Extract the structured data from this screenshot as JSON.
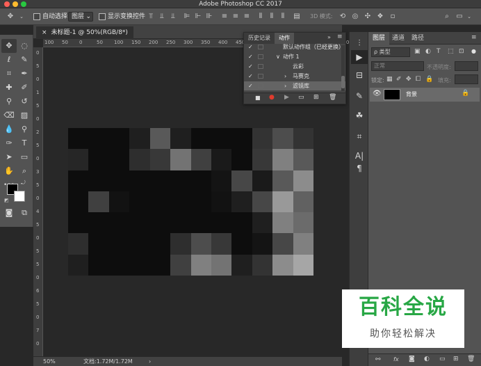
{
  "window": {
    "title": "Adobe Photoshop CC 2017"
  },
  "options_bar": {
    "auto_select_label": "自动选择:",
    "auto_select_value": "图层",
    "show_transform_label": "显示变换控件",
    "mode_3d_label": "3D 模式:"
  },
  "document": {
    "tab_title": "未标题-1 @ 50%(RGB/8*)",
    "close_label": "×",
    "ruler_top": [
      "100",
      "50",
      "0",
      "50",
      "100",
      "150",
      "200",
      "250",
      "300",
      "350",
      "400",
      "450",
      "500",
      "550",
      "600",
      "650",
      "700",
      "750",
      "800"
    ],
    "ruler_left": [
      "0",
      "5",
      "0",
      "1",
      "5",
      "0",
      "2",
      "5",
      "0",
      "3",
      "5",
      "0",
      "4",
      "5",
      "0",
      "5",
      "5",
      "0",
      "6",
      "5",
      "0",
      "7",
      "0"
    ]
  },
  "status": {
    "zoom": "50%",
    "doc_size": "文档:1.72M/1.72M",
    "arrow": "›"
  },
  "history_panel": {
    "tabs": [
      "历史记录",
      "动作"
    ],
    "active_tab": 1,
    "rows": [
      {
        "label": "默认动作组（已经更换）",
        "indent": 1,
        "expand": "",
        "check": "✓",
        "highlight": false
      },
      {
        "label": "动作 1",
        "indent": 1,
        "expand": "∨",
        "check": "✓",
        "highlight": false
      },
      {
        "label": "云彩",
        "indent": 2,
        "expand": "",
        "check": "✓",
        "highlight": false
      },
      {
        "label": "马赛克",
        "indent": 2,
        "expand": "›",
        "check": "✓",
        "highlight": false
      },
      {
        "label": "滤镜库",
        "indent": 2,
        "expand": "›",
        "check": "✓",
        "highlight": true
      }
    ]
  },
  "layers_panel": {
    "tabs": [
      "图层",
      "通道",
      "路径"
    ],
    "active_tab": 0,
    "filter_label": "ρ 类型",
    "blend_mode": "正常",
    "opacity_label": "不透明度:",
    "lock_label": "锁定:",
    "fill_label": "填充:",
    "layer_name": "背景"
  },
  "watermark": {
    "main": "百科全说",
    "sub": "助你轻松解决"
  },
  "colors": {
    "accent": "#28a745",
    "panel": "#535353",
    "canvas_bg": "#282828"
  },
  "mosaic": {
    "cols": 11,
    "rows": 7,
    "levels": [
      [
        0.05,
        0.05,
        0.05,
        0.12,
        0.35,
        0.12,
        0.05,
        0.05,
        0.05,
        0.2,
        0.3,
        0.2
      ],
      [
        0.15,
        0.05,
        0.05,
        0.18,
        0.22,
        0.45,
        0.25,
        0.1,
        0.05,
        0.22,
        0.5,
        0.35
      ],
      [
        0.05,
        0.05,
        0.05,
        0.05,
        0.05,
        0.05,
        0.05,
        0.08,
        0.28,
        0.1,
        0.35,
        0.55
      ],
      [
        0.05,
        0.25,
        0.07,
        0.05,
        0.05,
        0.05,
        0.05,
        0.07,
        0.12,
        0.28,
        0.6,
        0.38
      ],
      [
        0.05,
        0.05,
        0.05,
        0.05,
        0.05,
        0.05,
        0.05,
        0.05,
        0.05,
        0.12,
        0.5,
        0.42
      ],
      [
        0.18,
        0.05,
        0.05,
        0.05,
        0.05,
        0.18,
        0.3,
        0.22,
        0.05,
        0.08,
        0.28,
        0.5
      ],
      [
        0.12,
        0.05,
        0.05,
        0.05,
        0.05,
        0.25,
        0.5,
        0.45,
        0.12,
        0.2,
        0.55,
        0.65
      ]
    ]
  }
}
